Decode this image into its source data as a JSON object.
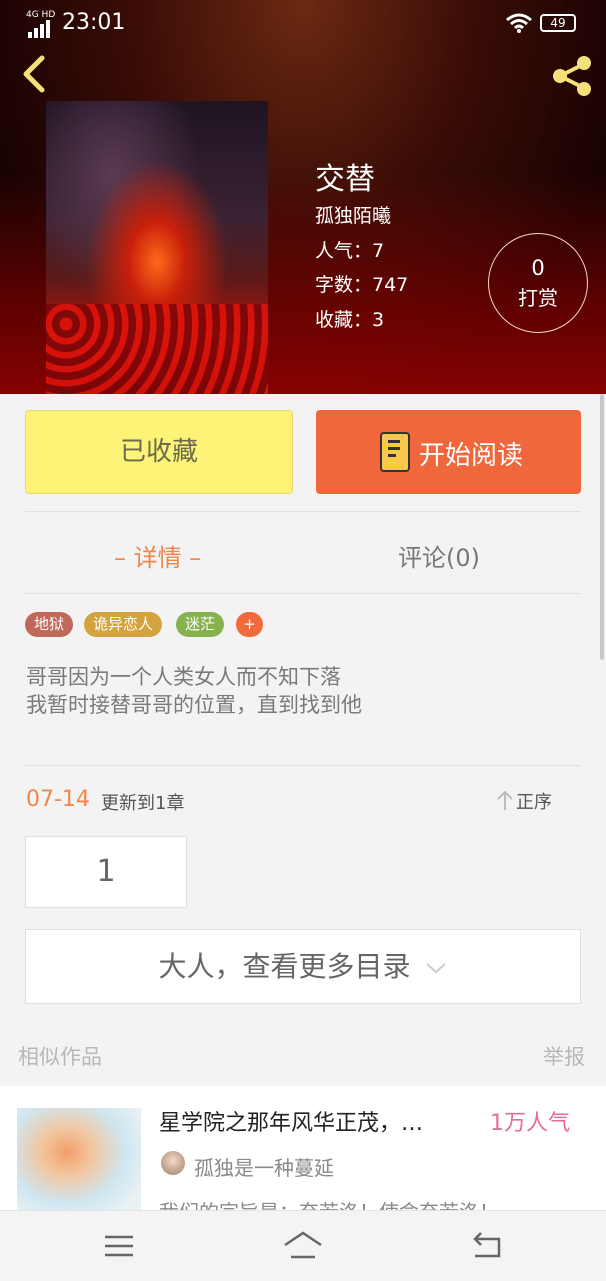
{
  "status_bar": {
    "network": "4G HD",
    "time": "23:01",
    "battery": "49"
  },
  "book": {
    "title": "交替",
    "author": "孤独陌曦",
    "popularity_label": "人气：7",
    "wordcount_label": "字数：747",
    "favorites_label": "收藏：3",
    "reward_count": "0",
    "reward_label": "打赏"
  },
  "actions": {
    "favorited_label": "已收藏",
    "read_label": "开始阅读"
  },
  "tabs": {
    "detail": "– 详情 –",
    "comments": "评论(0)"
  },
  "tags": [
    {
      "label": "地狱",
      "color": "#c0685a"
    },
    {
      "label": "诡异恋人",
      "color": "#d4a23e"
    },
    {
      "label": "迷茫",
      "color": "#86b24e"
    },
    {
      "label": "+",
      "color": "#f06a3c"
    }
  ],
  "description": {
    "line1": "哥哥因为一个人类女人而不知下落",
    "line2": "我暂时接替哥哥的位置，直到找到他"
  },
  "update": {
    "date": "07-14",
    "text": "更新到1章",
    "order_label": "正序"
  },
  "chapters": [
    "1"
  ],
  "more_catalog_label": "大人，查看更多目录",
  "similar": {
    "heading": "相似作品",
    "report_label": "举报",
    "items": [
      {
        "title": "星学院之那年风华正茂，…",
        "popularity": "1万人气",
        "author": "孤独是一种蔓延",
        "desc": "我们的宗旨是：奈若洛！使命奈若洛！"
      }
    ]
  }
}
